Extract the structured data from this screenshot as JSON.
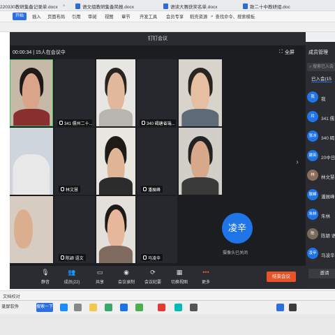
{
  "wps": {
    "tabs": [
      {
        "label": "220330教研集备记录单.docx"
      },
      {
        "label": "语文组教研集备简报.docx"
      },
      {
        "label": "语读大赛获奖名单.docx"
      },
      {
        "label": "致二十中教研组.doc"
      }
    ],
    "start_label": "开始",
    "menu": [
      "插入",
      "页面布局",
      "引用",
      "审阅",
      "视图",
      "章节",
      "开发工具",
      "会员专享",
      "稻壳资源"
    ],
    "search_label": "查找命令、搜索模板",
    "status_text": "文档校对"
  },
  "meeting": {
    "window_title": "钉钉会议",
    "timer": "00:00:34",
    "participants_in_meeting": "15人在会议中",
    "fullscreen_label": "全屏",
    "tiles": [
      {
        "name": ""
      },
      {
        "name": ""
      },
      {
        "name": "341 儒州二十..."
      },
      {
        "name": ""
      },
      {
        "name": "340 碣瑭省端..."
      },
      {
        "name": ""
      },
      {
        "name": ""
      },
      {
        "name": "林文慧"
      },
      {
        "name": ""
      },
      {
        "name": "潘展峰"
      },
      {
        "name": ""
      },
      {
        "name": "陈颖 语文"
      },
      {
        "name": ""
      },
      {
        "name": "马凌辛"
      }
    ],
    "camera_off": {
      "avatar_text": "凌辛",
      "label": "摄像头已关闭"
    },
    "toolbar": {
      "mute": "静音",
      "members": "成员(22)",
      "share": "共享",
      "record": "会议录制",
      "minutes": "会议纪要",
      "switch_view": "切换视图",
      "more": "更多",
      "end": "结束会议"
    }
  },
  "panel": {
    "title": "成员管理",
    "search_placeholder": "搜索已入会",
    "tab_label": "已入会(15",
    "members": [
      {
        "avatar": "我",
        "name": "我",
        "color": "#1f75e8"
      },
      {
        "avatar": "玲",
        "name": "341 儒",
        "color": "#1f75e8"
      },
      {
        "avatar": "张冰",
        "name": "340 碣",
        "color": "#1f75e8"
      },
      {
        "avatar": "建英",
        "name": "20中日",
        "color": "#1f75e8"
      },
      {
        "avatar": "林",
        "name": "林文慧",
        "color": "#8a6d5a"
      },
      {
        "avatar": "展峰",
        "name": "潘展峰",
        "color": "#1f75e8"
      },
      {
        "avatar": "朱林",
        "name": "朱林",
        "color": "#1f75e8"
      },
      {
        "avatar": "陈",
        "name": "陈颖 语",
        "color": "#7a6a5a"
      },
      {
        "avatar": "凌辛",
        "name": "马凌辛",
        "color": "#1f75e8"
      }
    ],
    "invite_label": "邀请"
  },
  "taskbar": {
    "app_label": "录屏软件",
    "search_button": "搜索一下"
  }
}
